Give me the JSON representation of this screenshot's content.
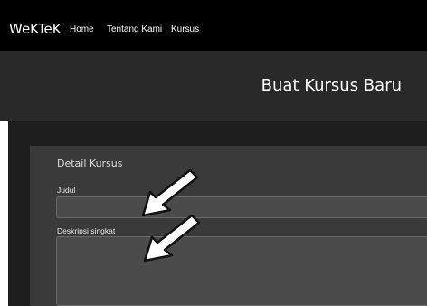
{
  "navbar": {
    "brand": "WeKTeK",
    "links": [
      "Home",
      "Tentang Kami",
      "Kursus"
    ]
  },
  "hero": {
    "title": "Buat Kursus Baru"
  },
  "form": {
    "heading": "Detail Kursus",
    "title_label": "Judul",
    "title_value": "",
    "description_label": "Deskripsi singkat",
    "description_value": ""
  },
  "annotations": {
    "arrow_icon": "white-arrow-icon"
  },
  "colors": {
    "navbar": "#000000",
    "hero": "#292929",
    "content": "#1e1e1e",
    "card": "#3a3a3a",
    "input": "#4b4b4b"
  }
}
